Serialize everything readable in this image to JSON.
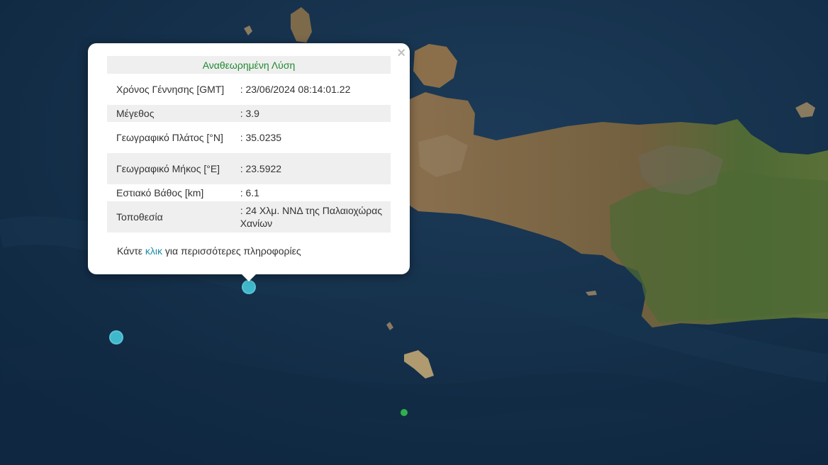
{
  "popup": {
    "close": "×",
    "title": "Αναθεωρημένη Λύση",
    "rows": [
      {
        "label": "Χρόνος Γέννησης [GMT]",
        "value": ": 23/06/2024 08:14:01.22"
      },
      {
        "label": "Μέγεθος",
        "value": ": 3.9"
      },
      {
        "label": "Γεωγραφικό Πλάτος [°N]",
        "value": ": 35.0235"
      },
      {
        "label": "Γεωγραφικό Μήκος [°E]",
        "value": ": 23.5922"
      },
      {
        "label": "Εστιακό Βάθος [km]",
        "value": ": 6.1"
      },
      {
        "label": "Τοποθεσία",
        "value": ": 24 Χλμ. ΝΝΔ της Παλαιοχώρας Χανίων"
      }
    ],
    "note_before": "Κάντε ",
    "note_link": "κλικ",
    "note_after": " για περισσότερες πληροφορίες"
  },
  "colors": {
    "sea": "#14304a",
    "land": "#7a6444",
    "vegetation": "#4d6a34",
    "quake_marker": "#3fb8cc",
    "minor_marker": "#2fb04a",
    "title_green": "#1e8a2f",
    "link": "#1a8ea8"
  }
}
